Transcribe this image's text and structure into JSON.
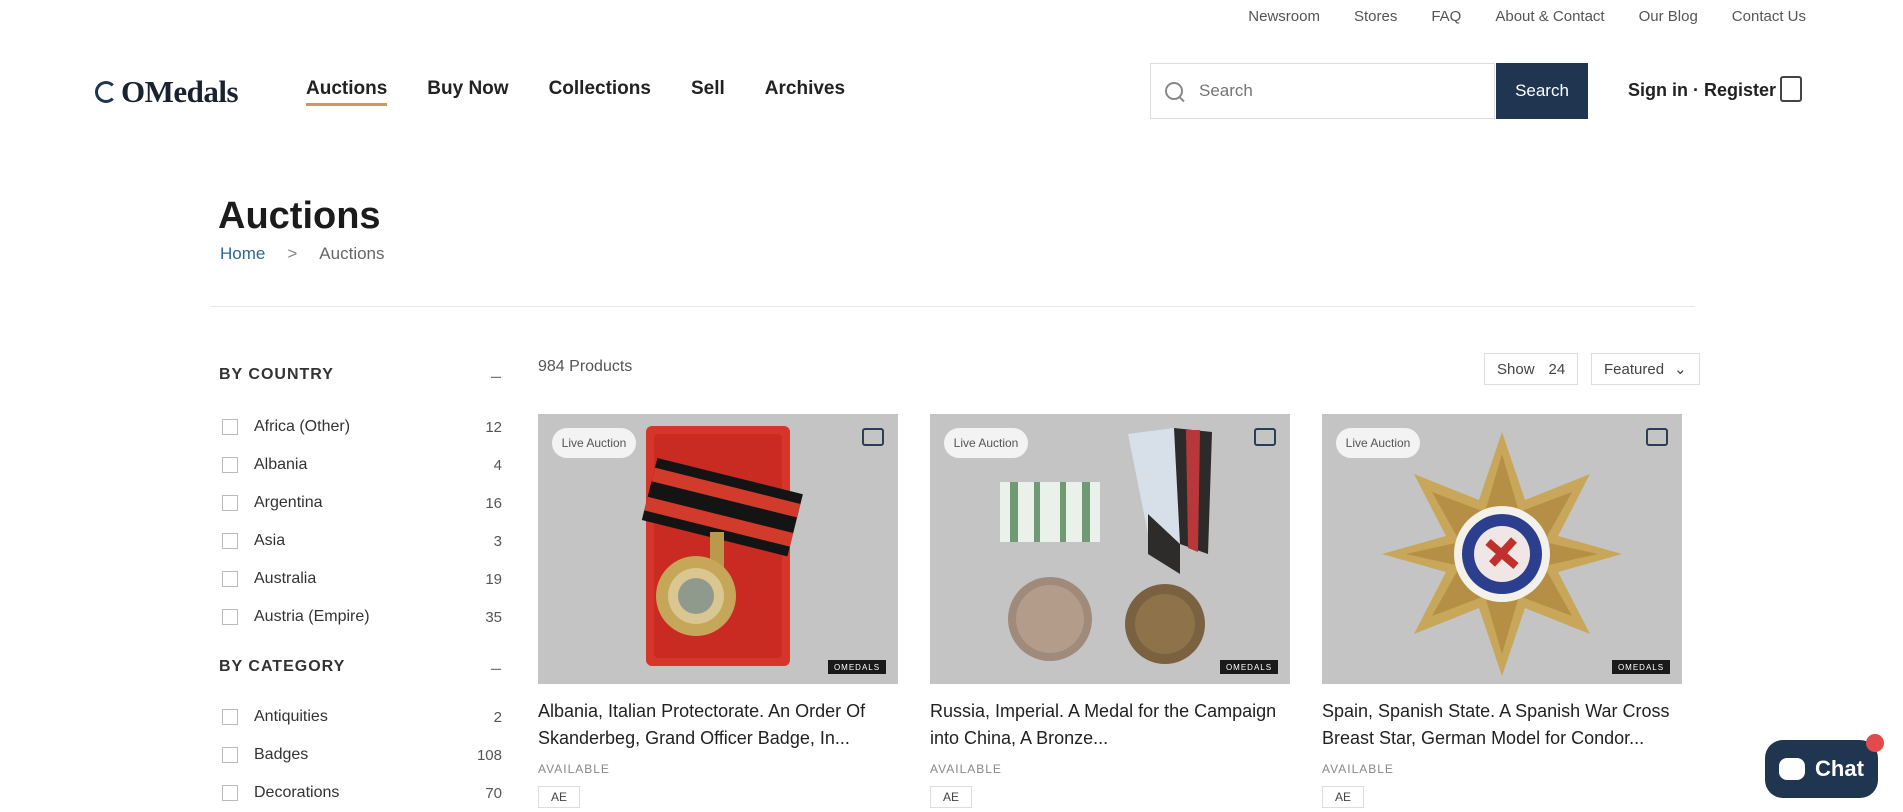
{
  "utility_nav": [
    "Newsroom",
    "Stores",
    "FAQ",
    "About & Contact",
    "Our Blog",
    "Contact Us"
  ],
  "brand": {
    "logo_text": "OMedals"
  },
  "main_nav": [
    {
      "label": "Auctions",
      "active": true
    },
    {
      "label": "Buy Now",
      "active": false
    },
    {
      "label": "Collections",
      "active": false
    },
    {
      "label": "Sell",
      "active": false
    },
    {
      "label": "Archives",
      "active": false
    }
  ],
  "search": {
    "placeholder": "Search",
    "button_label": "Search"
  },
  "account": {
    "label": "Sign in · Register"
  },
  "page": {
    "title": "Auctions",
    "breadcrumb_home": "Home",
    "breadcrumb_sep": ">",
    "breadcrumb_current": "Auctions"
  },
  "filters": {
    "country": {
      "heading": "BY COUNTRY",
      "toggle": "–",
      "items": [
        {
          "name": "Africa (Other)",
          "count": "12"
        },
        {
          "name": "Albania",
          "count": "4"
        },
        {
          "name": "Argentina",
          "count": "16"
        },
        {
          "name": "Asia",
          "count": "3"
        },
        {
          "name": "Australia",
          "count": "19"
        },
        {
          "name": "Austria (Empire)",
          "count": "35"
        }
      ]
    },
    "category": {
      "heading": "BY CATEGORY",
      "toggle": "–",
      "items": [
        {
          "name": "Antiquities",
          "count": "2"
        },
        {
          "name": "Badges",
          "count": "108"
        },
        {
          "name": "Decorations",
          "count": "70"
        }
      ]
    }
  },
  "toolbar": {
    "products_count": "984 Products",
    "show_label": "Show",
    "show_value": "24",
    "sort_label": "Featured"
  },
  "products": [
    {
      "badge": "Live Auction",
      "title": "Albania, Italian Protectorate. An Order Of Skanderbeg, Grand Officer Badge, In...",
      "status": "AVAILABLE",
      "tag": "AE",
      "watermark": "OMEDALS"
    },
    {
      "badge": "Live Auction",
      "title": "Russia, Imperial. A Medal for the Campaign into China, A Bronze...",
      "status": "AVAILABLE",
      "tag": "AE",
      "watermark": "OMEDALS"
    },
    {
      "badge": "Live Auction",
      "title": "Spain, Spanish State. A Spanish War Cross Breast Star, German Model for Condor...",
      "status": "AVAILABLE",
      "tag": "AE",
      "watermark": "OMEDALS"
    }
  ],
  "chat": {
    "label": "Chat"
  },
  "colors": {
    "brand_navy": "#1f3550",
    "accent_gold": "#c59d5f",
    "link_blue": "#2f6596",
    "image_bg": "#c4c4c4",
    "notify_red": "#e34b4b"
  }
}
